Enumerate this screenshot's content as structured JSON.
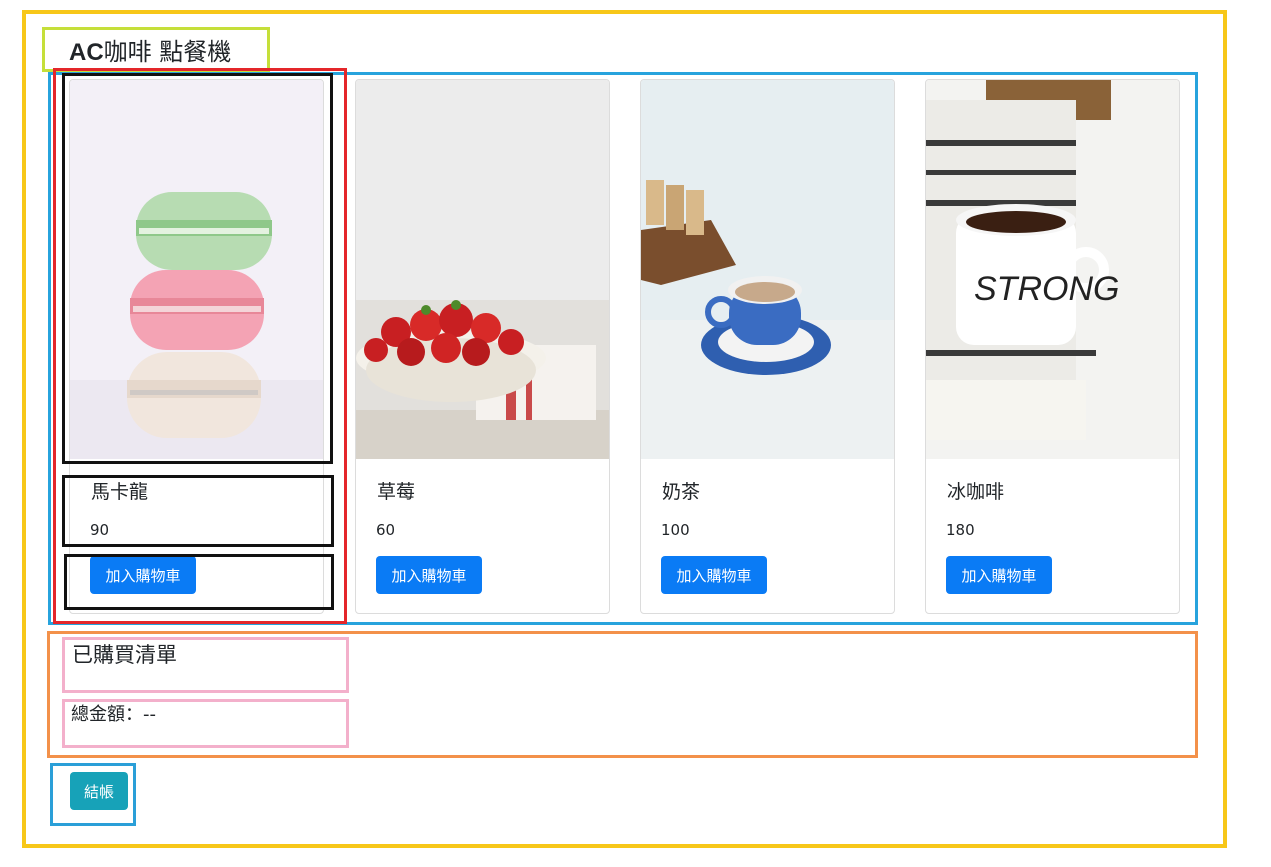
{
  "app": {
    "title_brand": "AC",
    "title_rest": "咖啡 點餐機"
  },
  "menu": {
    "items": [
      {
        "name": "馬卡龍",
        "price": "90",
        "button_label": "加入購物車",
        "image": "macaron-stack-photo"
      },
      {
        "name": "草莓",
        "price": "60",
        "button_label": "加入購物車",
        "image": "strawberry-bowl-photo"
      },
      {
        "name": "奶茶",
        "price": "100",
        "button_label": "加入購物車",
        "image": "milk-tea-cup-photo"
      },
      {
        "name": "冰咖啡",
        "price": "180",
        "button_label": "加入購物車",
        "image": "coffee-mug-photo"
      }
    ]
  },
  "order": {
    "title": "已購買清單",
    "total_label": "總金額：",
    "total_value": "--"
  },
  "checkout": {
    "label": "結帳"
  },
  "colors": {
    "primary_button": "#0a7bf5",
    "checkout_button": "#17a2b8",
    "frame_outer": "#f7c719",
    "frame_title": "#c5df3a",
    "frame_menu": "#27a3dd",
    "frame_selected_card": "#e4262a",
    "frame_order": "#f3914a",
    "frame_order_parts": "#f3b0cb"
  }
}
